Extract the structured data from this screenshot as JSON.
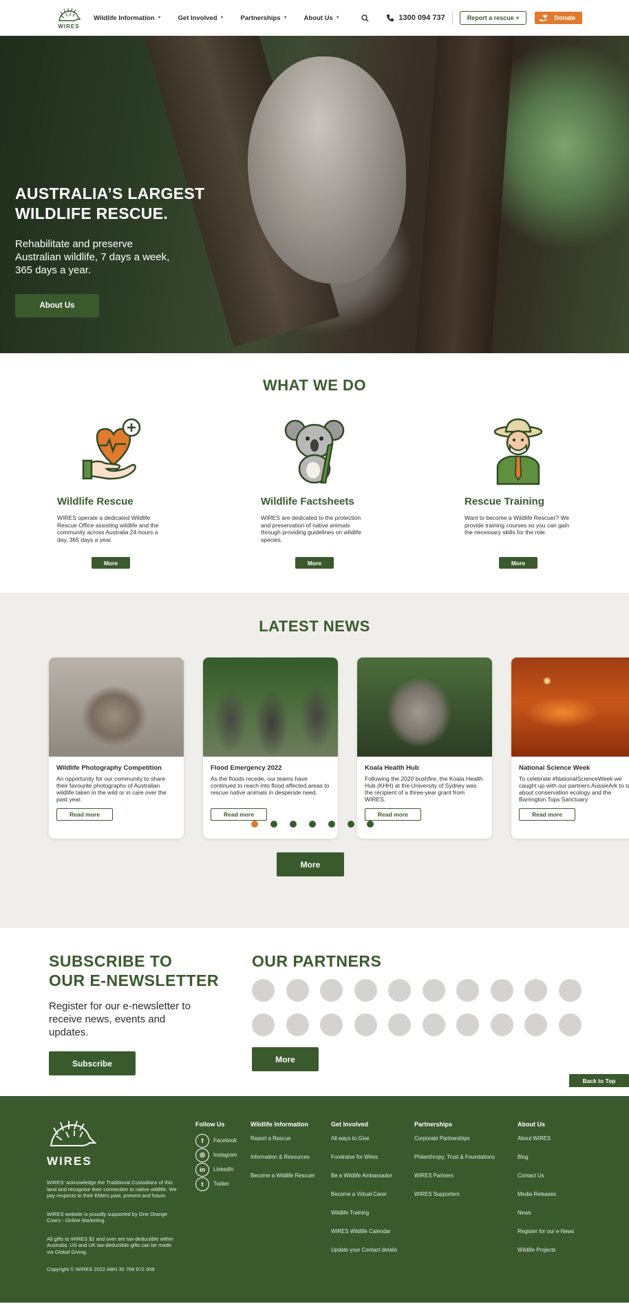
{
  "header": {
    "logo_text": "WIRES",
    "nav": [
      {
        "label": "Wildlife Information"
      },
      {
        "label": "Get Involved"
      },
      {
        "label": "Partnerships"
      },
      {
        "label": "About Us"
      }
    ],
    "phone": "1300 094 737",
    "report_label": "Report a rescue +",
    "donate_label": "Donate"
  },
  "hero": {
    "title": "AUSTRALIA’S LARGEST WILDLIFE RESCUE.",
    "subtitle": "Rehabilitate and preserve Australian wildlife, 7 days a week, 365 days a year.",
    "button": "About Us"
  },
  "what_we_do": {
    "title": "WHAT WE DO",
    "cards": [
      {
        "title": "Wildlife Rescue",
        "text": "WIRES operate a dedicated Wildlife Rescue Office assisting wildlife and the community across Australia 24-hours a day, 365 days a year.",
        "button": "More",
        "icon": "heart-hand-icon"
      },
      {
        "title": "Wildlife Factsheets",
        "text": "WIRES are dedicated to the protection and preservation of native animals through providing guidelines on wildlife species.",
        "button": "More",
        "icon": "koala-icon"
      },
      {
        "title": "Rescue Training",
        "text": "Want to become a Wildlife Rescuer? We provide training courses so you can gain the necessary skills for the role.",
        "button": "More",
        "icon": "rescuer-icon"
      }
    ]
  },
  "news": {
    "title": "LATEST NEWS",
    "items": [
      {
        "title": "Wildlife Photography Competition",
        "text": "An opportunity for our community to share their favourite photographs of Australian wildlife taken in the wild or in care over the past year.",
        "button": "Read more"
      },
      {
        "title": "Flood Emergency 2022",
        "text": "As the floods recede, our teams have continued to reach into flood affected areas to rescue native animals in desperate need.",
        "button": "Read more"
      },
      {
        "title": "Koala Health Hub",
        "text": "Following the 2020 bushfire, the Koala Health Hub (KHH) at the University of Sydney was the recipient of a three-year grant from WIRES.",
        "button": "Read more"
      },
      {
        "title": "National Science Week",
        "text": "To celebrate #NationalScienceWeek we caught up with our partners AussieArk to talk about conservation ecology and the Barrington Tops Sanctuary",
        "button": "Read more"
      }
    ],
    "dots_count": 7,
    "active_dot": 0,
    "more_label": "More"
  },
  "subscribe": {
    "title_line1": "SUBSCRIBE TO",
    "title_line2": "OUR E-NEWSLETTER",
    "text": "Register for our e-newsletter to receive news, events and updates.",
    "button": "Subscribe"
  },
  "partners": {
    "title": "OUR PARTNERS",
    "logo_count": 20,
    "button": "More"
  },
  "back_to_top": "Back to Top",
  "footer": {
    "logo_text": "WIRES",
    "acknowledgement": "WIRES' acknowledge the Traditional Custodians of this land and recognise their connection to native wildlife. We pay respects to their Elders past, present and future.",
    "support": "WIRES website is proudly supported by One Orange Cow's - Online Marketing.",
    "gifts": "All gifts to WIRES $2 and over are tax-deductible within Australia. US and UK tax-deductible gifts can be made via Global Giving.",
    "copyright": "Copyright © WIRES 2022 ABN 30 768 872 508",
    "follow": {
      "title": "Follow Us",
      "items": [
        {
          "label": "Facebook",
          "glyph": "f"
        },
        {
          "label": "Instagram",
          "glyph": "◎"
        },
        {
          "label": "LinkedIn",
          "glyph": "in"
        },
        {
          "label": "Twitter",
          "glyph": "t"
        }
      ]
    },
    "columns": [
      {
        "title": "Wildlife Information",
        "links": [
          "Report a Rescue",
          "Information & Resources",
          "Become a Wildlife Rescuer"
        ]
      },
      {
        "title": "Get Involved",
        "links": [
          "All ways to Give",
          "Fundraise for Wires",
          "Be a Wildlife Ambassador",
          "Become a Virtual Carer",
          "Wildlife Training",
          "WIRES Wildlife Calendar",
          "Update your Contact details"
        ]
      },
      {
        "title": "Partnerships",
        "links": [
          "Corporate Partnerships",
          "Philanthropy, Trust & Foundations",
          "WIRES Partners",
          "WIRES Supporters"
        ]
      },
      {
        "title": "About Us",
        "links": [
          "About WIRES",
          "Blog",
          "Contact Us",
          "Media Releases",
          "News",
          "Register for our e-News",
          "Wildlife Projects"
        ]
      }
    ]
  },
  "colors": {
    "brand_green": "#3a5a2e",
    "accent_orange": "#e07a2e",
    "news_bg": "#f0eeea"
  }
}
